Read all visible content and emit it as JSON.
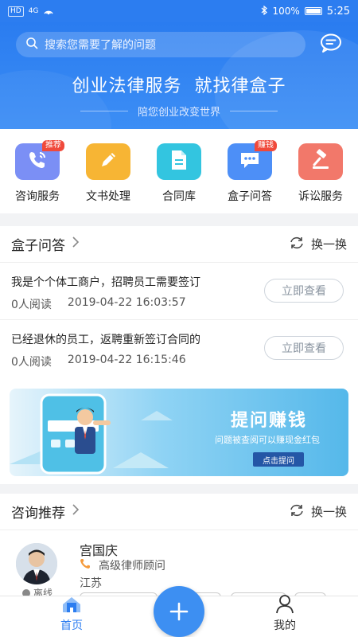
{
  "status_bar": {
    "network": "HD",
    "signal": "4G",
    "battery": "100%",
    "time": "5:25"
  },
  "header": {
    "search_placeholder": "搜索您需要了解的问题",
    "slogan": "创业法律服务  就找律盒子",
    "subslogan": "陪您创业改变世界"
  },
  "services": [
    {
      "label": "咨询服务",
      "badge": "推荐",
      "icon": "phone-chat-icon",
      "color": "#7b8ff5"
    },
    {
      "label": "文书处理",
      "badge": "",
      "icon": "pencil-icon",
      "color": "#f7b534"
    },
    {
      "label": "合同库",
      "badge": "",
      "icon": "document-icon",
      "color": "#33c5e0"
    },
    {
      "label": "盒子问答",
      "badge": "赚钱",
      "icon": "chat-bubble-icon",
      "color": "#4d8ff7"
    },
    {
      "label": "诉讼服务",
      "badge": "",
      "icon": "gavel-icon",
      "color": "#f2786a"
    }
  ],
  "qa_section": {
    "title": "盒子问答",
    "refresh_label": "换一换",
    "items": [
      {
        "question": "我是个个体工商户，招聘员工需要签订",
        "reads": "0人阅读",
        "time": "2019-04-22 16:03:57",
        "button": "立即查看"
      },
      {
        "question": "已经退休的员工，返聘重新签订合同的",
        "reads": "0人阅读",
        "time": "2019-04-22 16:15:46",
        "button": "立即查看"
      }
    ]
  },
  "banner": {
    "title": "提问赚钱",
    "subtitle": "问题被查阅可以赚现金红包",
    "button": "点击提问"
  },
  "consult_section": {
    "title": "咨询推荐",
    "refresh_label": "换一换",
    "lawyer": {
      "name": "宫国庆",
      "title": "高级律师顾问",
      "city": "江苏",
      "status": "离线"
    }
  },
  "bottom_nav": {
    "home": "首页",
    "mine": "我的"
  },
  "colors": {
    "primary": "#2c7df0",
    "badge": "#f0493b"
  }
}
